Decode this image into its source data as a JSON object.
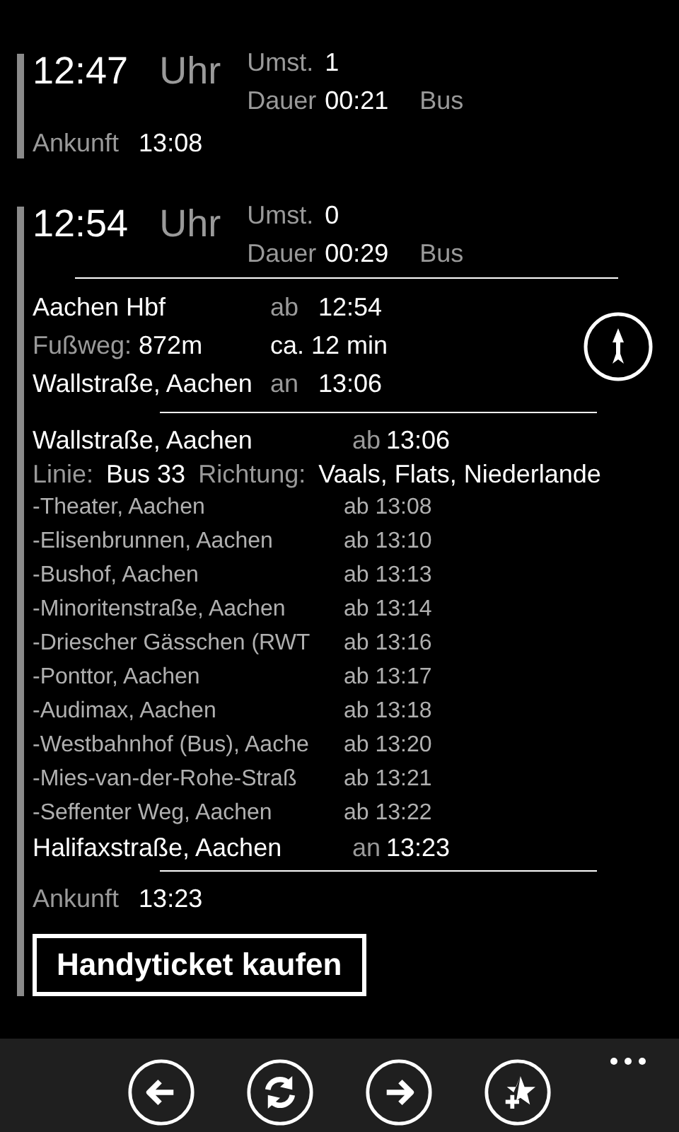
{
  "trips": [
    {
      "depart": "12:47",
      "unit": "Uhr",
      "changes_label": "Umst.",
      "changes": "1",
      "duration_label": "Dauer",
      "duration": "00:21",
      "mode": "Bus",
      "arrival_label": "Ankunft",
      "arrival": "13:08"
    },
    {
      "depart": "12:54",
      "unit": "Uhr",
      "changes_label": "Umst.",
      "changes": "0",
      "duration_label": "Dauer",
      "duration": "00:29",
      "mode": "Bus",
      "arrival_label": "Ankunft",
      "arrival": "13:23",
      "legs": [
        {
          "kind": "walk",
          "from": "Aachen Hbf",
          "dep_label": "ab",
          "dep": "12:54",
          "walk_label": "Fußweg:",
          "distance": "872m",
          "walk_time": "ca. 12 min",
          "to": "Wallstraße, Aachen",
          "arr_label": "an",
          "arr": "13:06"
        },
        {
          "kind": "bus",
          "from": "Wallstraße, Aachen",
          "dep_label": "ab",
          "dep": "13:06",
          "line_label": "Linie:",
          "line": "Bus 33",
          "direction_label": "Richtung:",
          "direction": "Vaals, Flats, Niederlande",
          "stops": [
            {
              "name": "-Theater, Aachen",
              "time": "ab 13:08"
            },
            {
              "name": "-Elisenbrunnen, Aachen",
              "time": "ab 13:10"
            },
            {
              "name": "-Bushof, Aachen",
              "time": "ab 13:13"
            },
            {
              "name": "-Minoritenstraße, Aachen",
              "time": "ab 13:14"
            },
            {
              "name": "-Driescher Gässchen (RWT",
              "time": "ab 13:16"
            },
            {
              "name": "-Ponttor, Aachen",
              "time": "ab 13:17"
            },
            {
              "name": "-Audimax, Aachen",
              "time": "ab 13:18"
            },
            {
              "name": "-Westbahnhof (Bus), Aache",
              "time": "ab 13:20"
            },
            {
              "name": "-Mies-van-der-Rohe-Straß",
              "time": "ab 13:21"
            },
            {
              "name": "-Seffenter Weg, Aachen",
              "time": "ab 13:22"
            }
          ],
          "to": "Halifaxstraße, Aachen",
          "arr_label": "an",
          "arr": "13:23"
        }
      ],
      "ticket_button": "Handyticket kaufen"
    }
  ],
  "app_bar": {
    "buttons": [
      {
        "kind": "back"
      },
      {
        "kind": "refresh"
      },
      {
        "kind": "forward"
      },
      {
        "kind": "favorite"
      }
    ]
  }
}
